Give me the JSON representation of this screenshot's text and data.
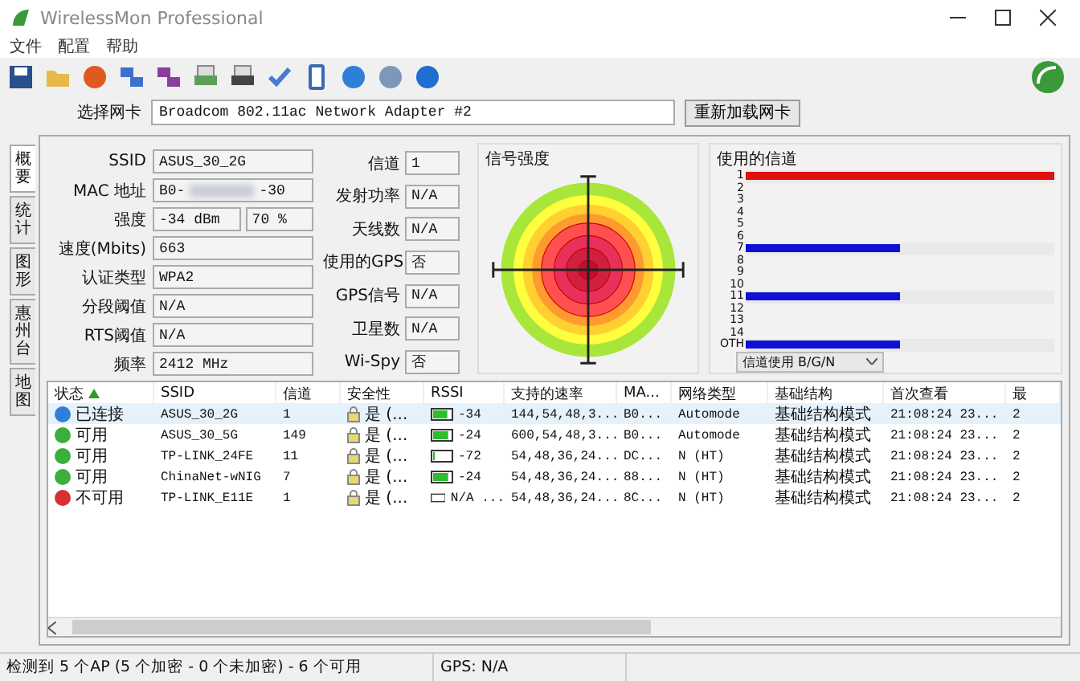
{
  "window": {
    "title": "WirelessMon Professional"
  },
  "menu": [
    "文件",
    "配置",
    "帮助"
  ],
  "adapter": {
    "label": "选择网卡",
    "value": "Broadcom 802.11ac Network Adapter #2",
    "button": "重新加载网卡"
  },
  "side_tabs": [
    {
      "label": "概要",
      "selected": true
    },
    {
      "label": "统计",
      "selected": false
    },
    {
      "label": "图形",
      "selected": false
    },
    {
      "label": "惠州台",
      "selected": false
    },
    {
      "label": "地图",
      "selected": false
    }
  ],
  "info_left": [
    {
      "label": "SSID",
      "values": [
        "ASUS_30_2G"
      ]
    },
    {
      "label": "MAC 地址",
      "values": [
        "B0-",
        "-30"
      ],
      "kind": "masked"
    },
    {
      "label": "强度",
      "values": [
        "-34 dBm",
        "70 %"
      ],
      "kind": "pair"
    },
    {
      "label": "速度(Mbits)",
      "values": [
        "663"
      ]
    },
    {
      "label": "认证类型",
      "values": [
        "WPA2"
      ]
    },
    {
      "label": "分段阈值",
      "values": [
        "N/A"
      ]
    },
    {
      "label": "RTS阈值",
      "values": [
        "N/A"
      ]
    },
    {
      "label": "频率",
      "values": [
        "2412 MHz"
      ]
    }
  ],
  "info_right": [
    {
      "label": "信道",
      "value": "1"
    },
    {
      "label": "发射功率",
      "value": "N/A"
    },
    {
      "label": "天线数",
      "value": "N/A"
    },
    {
      "label": "使用的GPS",
      "value": "否"
    },
    {
      "label": "GPS信号",
      "value": "N/A"
    },
    {
      "label": "卫星数",
      "value": "N/A"
    },
    {
      "label": "Wi-Spy",
      "value": "否"
    }
  ],
  "signal": {
    "title": "信号强度"
  },
  "channels": {
    "title": "使用的信道",
    "filter": "信道使用 B/G/N",
    "items": [
      {
        "label": "1",
        "level": 1,
        "color": "#e01010"
      },
      {
        "label": "2"
      },
      {
        "label": "3"
      },
      {
        "label": "4"
      },
      {
        "label": "5"
      },
      {
        "label": "6"
      },
      {
        "label": "7",
        "level": 0.5,
        "color": "#1010d0"
      },
      {
        "label": "8"
      },
      {
        "label": "9"
      },
      {
        "label": "10"
      },
      {
        "label": "11",
        "level": 0.5,
        "color": "#1010d0"
      },
      {
        "label": "12"
      },
      {
        "label": "13"
      },
      {
        "label": "14"
      },
      {
        "label": "OTH",
        "level": 0.5,
        "color": "#1010d0"
      }
    ]
  },
  "table": {
    "columns": [
      "状态",
      "SSID",
      "信道",
      "安全性",
      "RSSI",
      "支持的速率",
      "MA...",
      "网络类型",
      "基础结构",
      "首次查看",
      "最"
    ],
    "rows": [
      {
        "color": "#2f7fd8",
        "selected": true,
        "cells": [
          "已连接",
          "ASUS_30_2G",
          "1",
          "是 (...",
          "-34",
          "144,54,48,3...",
          "B0...",
          "Automode",
          "基础结构模式",
          "21:08:24 23...",
          "2"
        ],
        "level": 0.8
      },
      {
        "color": "#3cae3c",
        "selected": false,
        "cells": [
          "可用",
          "ASUS_30_5G",
          "149",
          "是 (...",
          "-24",
          "600,54,48,3...",
          "B0...",
          "Automode",
          "基础结构模式",
          "21:08:24 23...",
          "2"
        ],
        "level": 0.85
      },
      {
        "color": "#3cae3c",
        "selected": false,
        "cells": [
          "可用",
          "TP-LINK_24FE",
          "11",
          "是 (...",
          "-72",
          "54,48,36,24...",
          "DC...",
          "N (HT)",
          "基础结构模式",
          "21:08:24 23...",
          "2"
        ],
        "level": 0.1
      },
      {
        "color": "#3cae3c",
        "selected": false,
        "cells": [
          "可用",
          "ChinaNet-wNIG",
          "7",
          "是 (...",
          "-24",
          "54,48,36,24...",
          "88...",
          "N (HT)",
          "基础结构模式",
          "21:08:24 23...",
          "2"
        ],
        "level": 0.85
      },
      {
        "color": "#d83030",
        "selected": false,
        "cells": [
          "不可用",
          "TP-LINK_E11E",
          "1",
          "是 (...",
          "N/A ...",
          "54,48,36,24...",
          "8C...",
          "N (HT)",
          "基础结构模式",
          "21:08:24 23...",
          "2"
        ],
        "level": 0
      }
    ]
  },
  "status_bar": [
    "检测到 5 个AP (5 个加密 - 0 个未加密) - 6 个可用",
    "GPS: N/A"
  ]
}
